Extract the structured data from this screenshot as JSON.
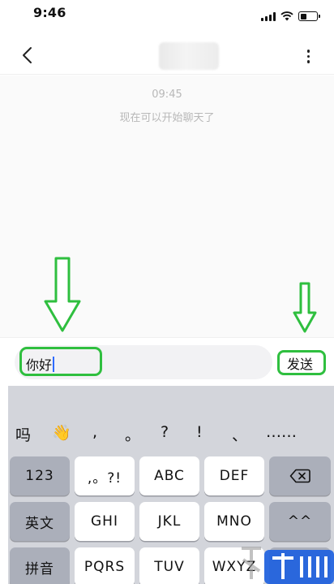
{
  "status_bar": {
    "time": "9:46"
  },
  "nav": {
    "back_icon": "chevron-left-icon",
    "more_icon": "more-vertical-icon"
  },
  "chat": {
    "timestamp": "09:45",
    "system_message": "现在可以开始聊天了"
  },
  "composer": {
    "input_value": "你好",
    "send_label": "发送"
  },
  "keyboard": {
    "suggestions": [
      "吗",
      "👋",
      ",",
      "。",
      "?",
      "!",
      "、",
      "……"
    ],
    "row1": [
      "123",
      ",。?!",
      "ABC",
      "DEF"
    ],
    "row2": [
      "英文",
      "GHI",
      "JKL",
      "MNO",
      "^^"
    ],
    "row3": [
      "拼音",
      "PQRS",
      "TUV",
      "WXYZ"
    ],
    "backspace_icon": "backspace-icon"
  },
  "colors": {
    "annotation_green": "#2fbf3f",
    "caret_blue": "#2f6bff",
    "watermark_blue": "#1c5fe0"
  }
}
